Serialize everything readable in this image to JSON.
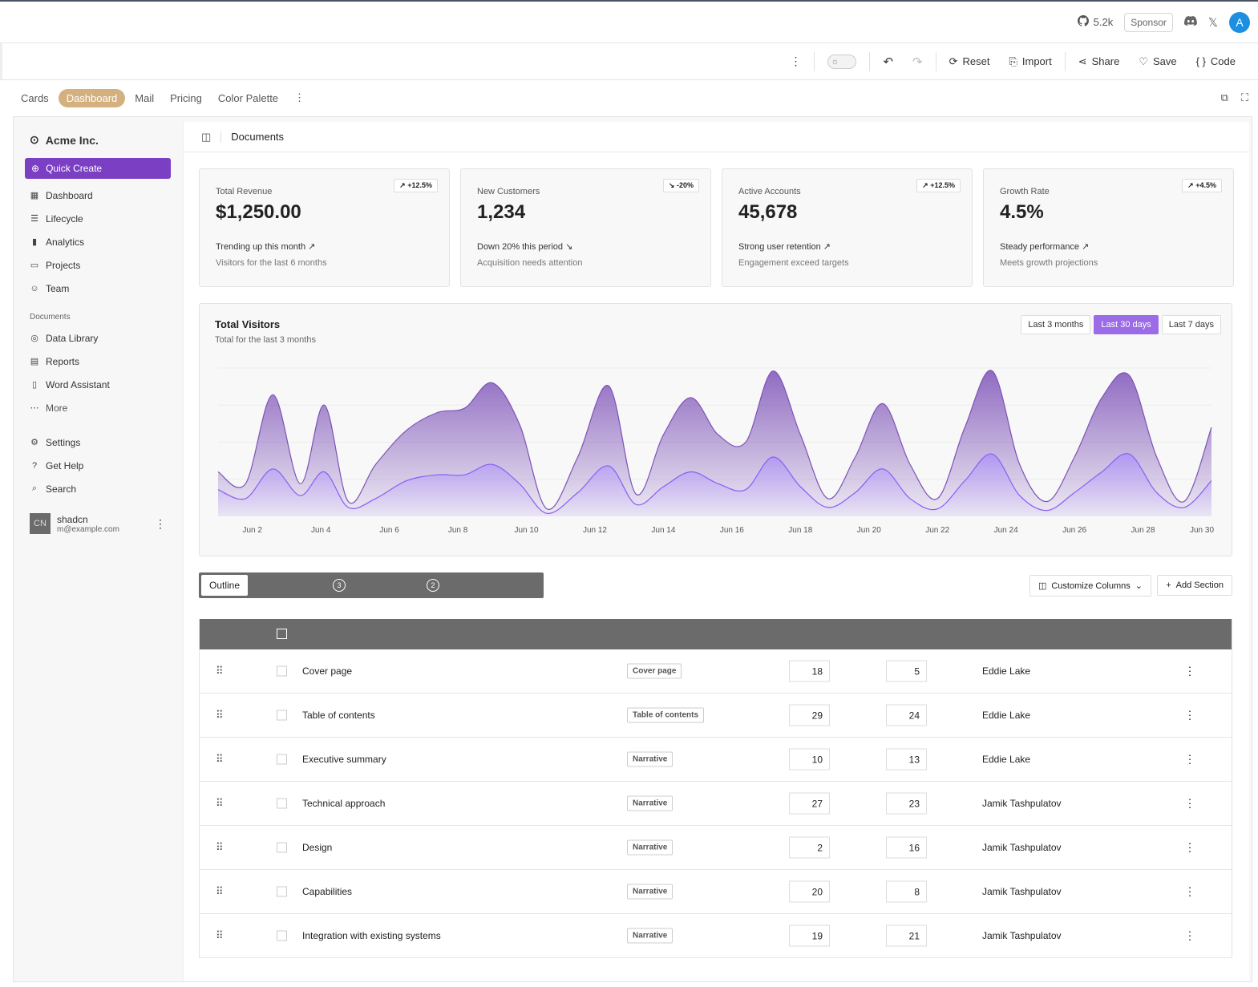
{
  "topbar": {
    "github_count": "5.2k",
    "sponsor_label": "Sponsor",
    "avatar_letter": "A"
  },
  "toolbar": {
    "reset_label": "Reset",
    "import_label": "Import",
    "share_label": "Share",
    "save_label": "Save",
    "code_label": "Code"
  },
  "tabs": [
    "Cards",
    "Dashboard",
    "Mail",
    "Pricing",
    "Color Palette"
  ],
  "active_tab": "Dashboard",
  "sidebar": {
    "brand": "Acme Inc.",
    "quick_create": "Quick Create",
    "nav": [
      {
        "label": "Dashboard",
        "icon": "dashboard-icon"
      },
      {
        "label": "Lifecycle",
        "icon": "list-icon"
      },
      {
        "label": "Analytics",
        "icon": "bar-chart-icon"
      },
      {
        "label": "Projects",
        "icon": "folder-icon"
      },
      {
        "label": "Team",
        "icon": "users-icon"
      }
    ],
    "documents_label": "Documents",
    "documents": [
      {
        "label": "Data Library",
        "icon": "database-icon"
      },
      {
        "label": "Reports",
        "icon": "clipboard-icon"
      },
      {
        "label": "Word Assistant",
        "icon": "file-icon"
      },
      {
        "label": "More",
        "icon": "ellipsis-icon"
      }
    ],
    "secondary": [
      {
        "label": "Settings",
        "icon": "gear-icon"
      },
      {
        "label": "Get Help",
        "icon": "help-icon"
      },
      {
        "label": "Search",
        "icon": "search-icon"
      }
    ],
    "user": {
      "initials": "CN",
      "name": "shadcn",
      "email": "m@example.com"
    }
  },
  "header": {
    "title": "Documents"
  },
  "cards": [
    {
      "label": "Total Revenue",
      "value": "$1,250.00",
      "badge": "+12.5%",
      "trend": "up",
      "line1": "Trending up this month",
      "line2": "Visitors for the last 6 months"
    },
    {
      "label": "New Customers",
      "value": "1,234",
      "badge": "-20%",
      "trend": "down",
      "line1": "Down 20% this period",
      "line2": "Acquisition needs attention"
    },
    {
      "label": "Active Accounts",
      "value": "45,678",
      "badge": "+12.5%",
      "trend": "up",
      "line1": "Strong user retention",
      "line2": "Engagement exceed targets"
    },
    {
      "label": "Growth Rate",
      "value": "4.5%",
      "badge": "+4.5%",
      "trend": "up",
      "line1": "Steady performance",
      "line2": "Meets growth projections"
    }
  ],
  "visitors": {
    "title": "Total Visitors",
    "subtitle": "Total for the last 3 months",
    "ranges": [
      "Last 3 months",
      "Last 30 days",
      "Last 7 days"
    ],
    "active_range": "Last 30 days"
  },
  "chart_data": {
    "type": "area",
    "title": "Total Visitors",
    "x_ticks": [
      "Jun 2",
      "Jun 4",
      "Jun 6",
      "Jun 8",
      "Jun 10",
      "Jun 12",
      "Jun 14",
      "Jun 16",
      "Jun 18",
      "Jun 20",
      "Jun 22",
      "Jun 24",
      "Jun 26",
      "Jun 28",
      "Jun 30"
    ],
    "x_points": [
      1,
      1.8,
      2.6,
      3.4,
      4.1,
      4.8,
      5.6,
      6.5,
      7.4,
      8.2,
      9.0,
      9.8,
      10.6,
      11.5,
      12.4,
      13.2,
      14.0,
      14.8,
      15.6,
      16.4,
      17.2,
      18.0,
      18.8,
      19.6,
      20.4,
      21.2,
      22.0,
      22.8,
      23.6,
      24.4,
      25.2,
      26.0,
      26.8,
      27.6,
      28.4,
      29.2,
      30
    ],
    "series": [
      {
        "name": "",
        "color": "#7d52b8",
        "values": [
          30,
          22,
          82,
          22,
          75,
          10,
          35,
          58,
          70,
          73,
          90,
          62,
          5,
          40,
          88,
          15,
          55,
          80,
          55,
          50,
          98,
          55,
          12,
          40,
          76,
          35,
          12,
          60,
          98,
          35,
          10,
          40,
          80,
          95,
          40,
          10,
          60
        ]
      },
      {
        "name": "",
        "color": "#8b5cf6",
        "values": [
          18,
          12,
          32,
          14,
          30,
          6,
          12,
          24,
          28,
          28,
          35,
          22,
          2,
          16,
          34,
          8,
          20,
          30,
          22,
          18,
          40,
          20,
          6,
          16,
          32,
          12,
          5,
          24,
          42,
          14,
          4,
          16,
          30,
          42,
          16,
          6,
          24
        ]
      }
    ]
  },
  "table_controls": {
    "outline_label": "Outline",
    "badge_1": "3",
    "badge_2": "2",
    "customize_label": "Customize Columns",
    "add_section_label": "Add Section"
  },
  "rows": [
    {
      "title": "Cover page",
      "type": "Cover page",
      "target": "18",
      "limit": "5",
      "reviewer": "Eddie Lake"
    },
    {
      "title": "Table of contents",
      "type": "Table of contents",
      "target": "29",
      "limit": "24",
      "reviewer": "Eddie Lake"
    },
    {
      "title": "Executive summary",
      "type": "Narrative",
      "target": "10",
      "limit": "13",
      "reviewer": "Eddie Lake"
    },
    {
      "title": "Technical approach",
      "type": "Narrative",
      "target": "27",
      "limit": "23",
      "reviewer": "Jamik Tashpulatov"
    },
    {
      "title": "Design",
      "type": "Narrative",
      "target": "2",
      "limit": "16",
      "reviewer": "Jamik Tashpulatov"
    },
    {
      "title": "Capabilities",
      "type": "Narrative",
      "target": "20",
      "limit": "8",
      "reviewer": "Jamik Tashpulatov"
    },
    {
      "title": "Integration with existing systems",
      "type": "Narrative",
      "target": "19",
      "limit": "21",
      "reviewer": "Jamik Tashpulatov"
    }
  ]
}
